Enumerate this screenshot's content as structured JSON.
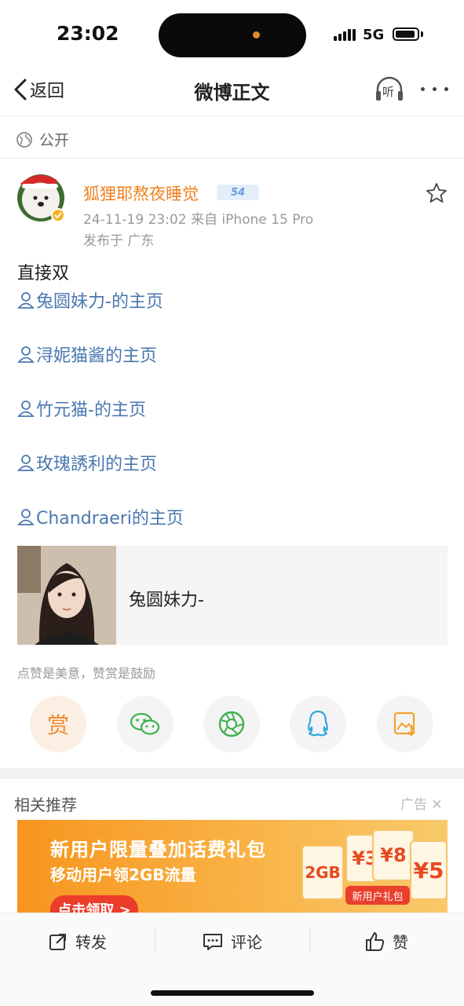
{
  "status_bar": {
    "time": "23:02",
    "network": "5G"
  },
  "nav": {
    "back_label": "返回",
    "title": "微博正文",
    "listen_label": "听"
  },
  "visibility": "公开",
  "post": {
    "username": "狐狸耶熬夜睡觉",
    "level": "54",
    "timestamp_source": "24-11-19 23:02  来自 iPhone 15 Pro",
    "location": "发布于 广东",
    "text": "直接双",
    "mentions": [
      "兔圆妹力-的主页",
      "浔妮猫酱的主页",
      "竹元猫-的主页",
      "玫瑰誘利的主页",
      "Chandraeri的主页"
    ],
    "card_title": "兔圆妹力-"
  },
  "reward_tip": "点赞是美意，赞赏是鼓励",
  "share_bar": {
    "reward_label": "赏"
  },
  "recommend": {
    "title": "相关推荐",
    "ad_label": "广告"
  },
  "banner": {
    "headline": "新用户限量叠加话费礼包",
    "sub": "移动用户领2GB流量",
    "button": "点击领取 >",
    "coupons": [
      "2GB",
      "¥3",
      "¥8",
      "¥5"
    ],
    "gift_label": "新用户礼包"
  },
  "actions": {
    "repost": "转发",
    "comment": "评论",
    "like": "赞"
  },
  "colors": {
    "username": "#f07f1c",
    "mention": "#4a77b0",
    "accent": "#f08a2c"
  }
}
